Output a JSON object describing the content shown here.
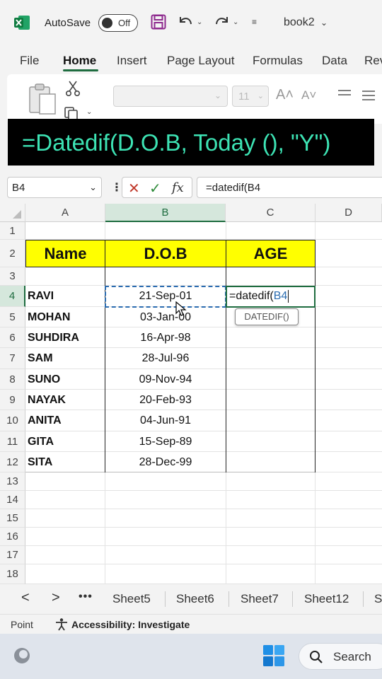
{
  "titlebar": {
    "autosave_label": "AutoSave",
    "autosave_state": "Off",
    "workbook_name": "book2"
  },
  "ribbon_tabs": [
    "File",
    "Home",
    "Insert",
    "Page Layout",
    "Formulas",
    "Data",
    "Rev"
  ],
  "ribbon": {
    "font_size": "11",
    "grow_font": "A˄",
    "shrink_font": "A˅"
  },
  "banner": {
    "text": "=Datedif(D.O.B, Today (), \"Y\")"
  },
  "formula_bar": {
    "name_box": "B4",
    "formula": "=datedif(B4"
  },
  "columns": [
    "A",
    "B",
    "C",
    "D"
  ],
  "rows": [
    "1",
    "2",
    "3",
    "4",
    "5",
    "6",
    "7",
    "8",
    "9",
    "10",
    "11",
    "12",
    "13",
    "14",
    "15",
    "16",
    "17",
    "18"
  ],
  "table": {
    "headers": [
      "Name",
      "D.O.B",
      "AGE"
    ],
    "records": [
      {
        "name": "RAVI",
        "dob": "21-Sep-01"
      },
      {
        "name": "MOHAN",
        "dob": "03-Jan-00"
      },
      {
        "name": "SUHDIRA",
        "dob": "16-Apr-98"
      },
      {
        "name": "SAM",
        "dob": "28-Jul-96"
      },
      {
        "name": "SUNO",
        "dob": "09-Nov-94"
      },
      {
        "name": "NAYAK",
        "dob": "20-Feb-93"
      },
      {
        "name": "ANITA",
        "dob": "04-Jun-91"
      },
      {
        "name": "GITA",
        "dob": "15-Sep-89"
      },
      {
        "name": "SITA",
        "dob": "28-Dec-99"
      }
    ]
  },
  "edit_cell": {
    "prefix": "=datedif(",
    "ref": "B4"
  },
  "tooltip": "DATEDIF()",
  "sheet_tabs": [
    "Sheet5",
    "Sheet6",
    "Sheet7",
    "Sheet12",
    "S"
  ],
  "sheet_nav": {
    "prev": "<",
    "next": ">",
    "more": "•••"
  },
  "status": {
    "mode": "Point",
    "accessibility": "Accessibility: Investigate"
  },
  "taskbar": {
    "search_label": "Search"
  },
  "colors": {
    "excel_green": "#1e6c3f",
    "banner_text": "#3de3b4",
    "header_fill": "#ffff00",
    "ref_blue": "#2b6cb0"
  }
}
